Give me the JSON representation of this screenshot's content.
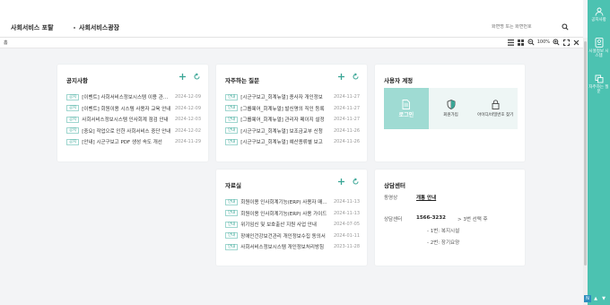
{
  "header": {
    "logo": "사회서비스 포탈",
    "portal_link": "사회서비스광장",
    "search_placeholder": "화면명 또는 화면번호"
  },
  "subbar": {
    "home_label": "홈",
    "zoom_level": "100%"
  },
  "sidebar": {
    "items": [
      {
        "label": "공지사항"
      },
      {
        "label": "시설정보 시스템"
      },
      {
        "label": "자주하는 질문"
      }
    ]
  },
  "notice": {
    "title": "공지사항",
    "rows": [
      {
        "badge": "공지",
        "title": "[이벤트] 사회서비스정보시스템 이용 관련 안내",
        "date": "2024-12-09"
      },
      {
        "badge": "공지",
        "title": "[이벤트] 회원이용 시스템 사용자 교육 안내",
        "date": "2024-12-09"
      },
      {
        "badge": "공지",
        "title": "사회서비스정보시스템 인사회계 점검 안내",
        "date": "2024-12-03"
      },
      {
        "badge": "공지",
        "title": "[중요] 작업으로 인한 사회서비스 중단 안내",
        "date": "2024-12-02"
      },
      {
        "badge": "공지",
        "title": "[안내] 시군구보고 PDF 생성 속도 개선",
        "date": "2024-11-29"
      }
    ]
  },
  "faq": {
    "title": "자주하는 질문",
    "rows": [
      {
        "badge": "안내",
        "title": "[시군구보고_회계뉴얼] 종사자 개인정보",
        "date": "2024-11-27"
      },
      {
        "badge": "안내",
        "title": "[그룹웨어_회계뉴얼] 발신명의 직인 등록",
        "date": "2024-11-27"
      },
      {
        "badge": "안내",
        "title": "[그룹웨어_회계뉴얼] 관리자 페이지 설정",
        "date": "2024-11-27"
      },
      {
        "badge": "안내",
        "title": "[시군구보고_회계뉴얼] 보조금교부 신청",
        "date": "2024-11-26"
      },
      {
        "badge": "안내",
        "title": "[시군구보고_회계뉴얼] 예산종류별 보고",
        "date": "2024-11-26"
      }
    ]
  },
  "account": {
    "title": "사용자 계정",
    "login": "로그인",
    "signup": "회원가입",
    "find": "아이디/비밀번호 찾기"
  },
  "files": {
    "title": "자료실",
    "rows": [
      {
        "badge": "안내",
        "title": "회원이용 인사회계기능(ERP) 사용자 매뉴얼",
        "date": "2024-11-13"
      },
      {
        "badge": "안내",
        "title": "회원이용 인사회계기능(ERP) 사용 가이드",
        "date": "2024-11-13"
      },
      {
        "badge": "안내",
        "title": "위기임신 및 보호출산 지원 사업 안내",
        "date": "2024-07-05"
      },
      {
        "badge": "안내",
        "title": "장애인건강보건관리 개인정보수집 동의서",
        "date": "2024-01-11"
      },
      {
        "badge": "안내",
        "title": "사회서비스정보시스템 개인정보처리방침",
        "date": "2023-11-28"
      }
    ]
  },
  "help": {
    "title": "상담센터",
    "video_label": "동영상",
    "video_link": "개통 안내",
    "center_label": "상담센터",
    "phone": "1566-3232",
    "phone_note": "> 3번 선택 후",
    "option1": "- 1번: 복지시설",
    "option2": "- 2번: 장기요양"
  },
  "colors": {
    "accent": "#4cc2b1",
    "badge": "#3aa696",
    "login_bg": "#9fdbd3"
  }
}
